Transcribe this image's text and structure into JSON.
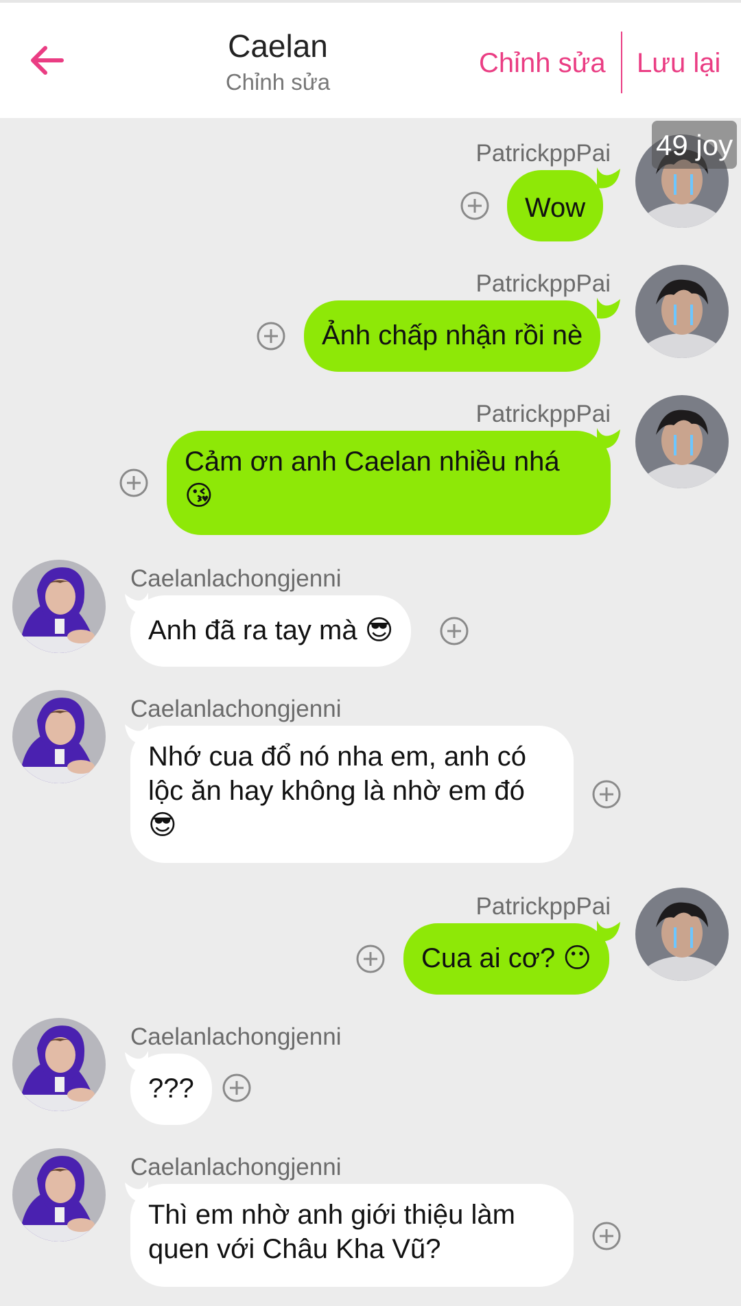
{
  "header": {
    "title": "Caelan",
    "subtitle": "Chỉnh sửa",
    "edit_label": "Chỉnh sửa",
    "save_label": "Lưu lại"
  },
  "badge": {
    "text": "49 joy"
  },
  "colors": {
    "accent": "#ea3d83",
    "outgoing_bubble": "#8ee807",
    "incoming_bubble": "#ffffff",
    "background": "#ececec"
  },
  "messages": [
    {
      "sender": "PatrickppPai",
      "text": "Wow",
      "direction": "outgoing"
    },
    {
      "sender": "PatrickppPai",
      "text": "Ảnh chấp nhận rồi nè",
      "direction": "outgoing"
    },
    {
      "sender": "PatrickppPai",
      "text": "Cảm ơn anh Caelan nhiều nhá",
      "emoji": "😘",
      "direction": "outgoing"
    },
    {
      "sender": "Caelanlachongjenni",
      "text": "Anh đã ra tay mà",
      "emoji": "😎",
      "direction": "incoming"
    },
    {
      "sender": "Caelanlachongjenni",
      "text_line1": "Nhớ cua đổ nó nha em, anh có",
      "text_line2": "lộc ăn hay không là nhờ em đó",
      "emoji": "😎",
      "direction": "incoming"
    },
    {
      "sender": "PatrickppPai",
      "text": "Cua ai cơ?",
      "emoji": "😶",
      "direction": "outgoing"
    },
    {
      "sender": "Caelanlachongjenni",
      "text": "???",
      "direction": "incoming"
    },
    {
      "sender": "Caelanlachongjenni",
      "text_line1": "Thì em nhờ anh giới thiệu làm",
      "text_line2": "quen với Châu Kha Vũ?",
      "direction": "incoming"
    }
  ]
}
